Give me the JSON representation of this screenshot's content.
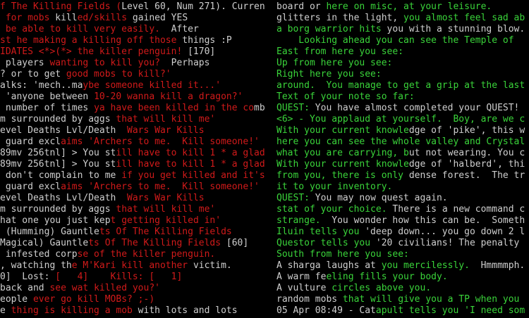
{
  "left_lines": [
    [
      {
        "t": "f The Killing Fields (",
        "c": "r"
      },
      {
        "t": "Level 60, Num 271). Curren",
        "c": "w"
      }
    ],
    [
      {
        "t": " for mobs ",
        "c": "r"
      },
      {
        "t": "kill",
        "c": "w"
      },
      {
        "t": "ed/skills ",
        "c": "r"
      },
      {
        "t": "gained YES",
        "c": "w"
      }
    ],
    [
      {
        "t": " be able to kill very easily.  ",
        "c": "r"
      },
      {
        "t": "After",
        "c": "w"
      }
    ],
    [
      {
        "t": "st he making a killing off those ",
        "c": "r"
      },
      {
        "t": "things :P",
        "c": "w"
      }
    ],
    [
      {
        "t": "IDATES <*>(*> the killer penguin! ",
        "c": "r"
      },
      {
        "t": "[170]",
        "c": "w"
      }
    ],
    [
      {
        "t": " players ",
        "c": "w"
      },
      {
        "t": "wanting to kill you?  ",
        "c": "r"
      },
      {
        "t": "Perhaps",
        "c": "w"
      }
    ],
    [
      {
        "t": "? or to get ",
        "c": "w"
      },
      {
        "t": "good mobs to kill?'",
        "c": "r"
      }
    ],
    [
      {
        "t": "alks: 'mech..ma",
        "c": "w"
      },
      {
        "t": "ybe someone killed it...'",
        "c": "r"
      }
    ],
    [
      {
        "t": " 'anyone between ",
        "c": "w"
      },
      {
        "t": "10-20 wanna kill a dragon?'",
        "c": "r"
      }
    ],
    [
      {
        "t": " number of times ",
        "c": "w"
      },
      {
        "t": "ya have been killed in the co",
        "c": "r"
      },
      {
        "t": "mb",
        "c": "w"
      }
    ],
    [
      {
        "t": "m surrounded by aggs ",
        "c": "w"
      },
      {
        "t": "that will kill me'",
        "c": "r"
      }
    ],
    [
      {
        "t": "evel Deaths Lvl/Death  ",
        "c": "w"
      },
      {
        "t": "Wars War Kills",
        "c": "r"
      }
    ],
    [
      {
        "t": " guard excl",
        "c": "w"
      },
      {
        "t": "aims 'Archers to me.  Kill someone!'",
        "c": "r"
      }
    ],
    [
      {
        "t": "89mv 256tnl] > You st",
        "c": "w"
      },
      {
        "t": "ill have to kill 1 * a glad",
        "c": "r"
      }
    ],
    [
      {
        "t": "89mv 256tnl] > You st",
        "c": "w"
      },
      {
        "t": "ill have to kill 1 * a glad",
        "c": "r"
      }
    ],
    [
      {
        "t": " don't complain to me ",
        "c": "w"
      },
      {
        "t": "if you get killed and it's",
        "c": "r"
      }
    ],
    [
      {
        "t": " guard excl",
        "c": "w"
      },
      {
        "t": "aims 'Archers to me.  Kill someone!'",
        "c": "r"
      }
    ],
    [
      {
        "t": "evel Deaths Lvl/Death  ",
        "c": "w"
      },
      {
        "t": "Wars War Kills",
        "c": "r"
      }
    ],
    [
      {
        "t": "m surrounded by aggs ",
        "c": "w"
      },
      {
        "t": "that will kill me'",
        "c": "r"
      }
    ],
    [
      {
        "t": "hat one you just kep",
        "c": "w"
      },
      {
        "t": "t getting killed in'",
        "c": "r"
      }
    ],
    [
      {
        "t": " (Humming) Gauntle",
        "c": "w"
      },
      {
        "t": "ts Of The Killing Fields",
        "c": "r"
      }
    ],
    [
      {
        "t": "Magical) Gauntle",
        "c": "w"
      },
      {
        "t": "ts Of The Killing Fields ",
        "c": "r"
      },
      {
        "t": "[60]",
        "c": "w"
      }
    ],
    [
      {
        "t": " infested corp",
        "c": "w"
      },
      {
        "t": "se of the killer penguin.",
        "c": "r"
      }
    ],
    [
      {
        "t": ", watching th",
        "c": "w"
      },
      {
        "t": "e M'Kari kill another ",
        "c": "r"
      },
      {
        "t": "victim.",
        "c": "w"
      }
    ],
    [
      {
        "t": "0]  Lost: ",
        "c": "w"
      },
      {
        "t": "[   4]    Kills: [   1]",
        "c": "r"
      }
    ],
    [
      {
        "t": "back and ",
        "c": "w"
      },
      {
        "t": "see wat killed you?'",
        "c": "r"
      }
    ],
    [
      {
        "t": "eople ",
        "c": "w"
      },
      {
        "t": "ever go kill MOBs? ;-)",
        "c": "r"
      }
    ],
    [
      {
        "t": "e ",
        "c": "w"
      },
      {
        "t": "thing is killing a mob ",
        "c": "r"
      },
      {
        "t": "with lots and lots",
        "c": "w"
      }
    ]
  ],
  "right_lines": [
    [
      {
        "t": "board or ",
        "c": "w"
      },
      {
        "t": "here on misc, at your leisure.",
        "c": "g"
      }
    ],
    [
      {
        "t": "glitters in the light, ",
        "c": "w"
      },
      {
        "t": "you almost feel sad ab",
        "c": "g"
      }
    ],
    [
      {
        "t": "a borg warrior hits ",
        "c": "g"
      },
      {
        "t": "you with a stunning blow.",
        "c": "w"
      }
    ],
    [
      {
        "t": "    Looking ahead ",
        "c": "g"
      },
      {
        "t": "you can see the Temple of",
        "c": "g"
      }
    ],
    [
      {
        "t": "East from here ",
        "c": "g"
      },
      {
        "t": "you see:",
        "c": "g"
      }
    ],
    [
      {
        "t": "Up from here ",
        "c": "g"
      },
      {
        "t": "you see:",
        "c": "g"
      }
    ],
    [
      {
        "t": "Right here ",
        "c": "g"
      },
      {
        "t": "you see:",
        "c": "g"
      }
    ],
    [
      {
        "t": "around.  You manage to get a grip at the last",
        "c": "g"
      }
    ],
    [
      {
        "t": "Text of your note so far:",
        "c": "g"
      }
    ],
    [
      {
        "t": "QUEST: ",
        "c": "g"
      },
      {
        "t": "You have almost completed your QUEST!",
        "c": "w"
      }
    ],
    [
      {
        "t": "<6> - ",
        "c": "g"
      },
      {
        "t": "You applaud at yourself.  Boy, are we c",
        "c": "g"
      }
    ],
    [
      {
        "t": "With your current knowle",
        "c": "g"
      },
      {
        "t": "dge of 'pike', this w",
        "c": "w"
      }
    ],
    [
      {
        "t": "here you can see the whole valley and Crystal",
        "c": "g"
      }
    ],
    [
      {
        "t": "what you are carrying, b",
        "c": "g"
      },
      {
        "t": "ut not wearing. You c",
        "c": "w"
      }
    ],
    [
      {
        "t": "With your current knowle",
        "c": "g"
      },
      {
        "t": "dge of 'halberd', thi",
        "c": "w"
      }
    ],
    [
      {
        "t": "from you, there is only ",
        "c": "g"
      },
      {
        "t": "dense forest.  The tr",
        "c": "w"
      }
    ],
    [
      {
        "t": "it to your inventory.",
        "c": "g"
      }
    ],
    [
      {
        "t": "QUEST: ",
        "c": "g"
      },
      {
        "t": "You may now quest again.",
        "c": "w"
      }
    ],
    [
      {
        "t": "stat of your choice. ",
        "c": "g"
      },
      {
        "t": "There is a new command c",
        "c": "w"
      }
    ],
    [
      {
        "t": "strange.  ",
        "c": "g"
      },
      {
        "t": "You wonder how this can be.  Someth",
        "c": "w"
      }
    ],
    [
      {
        "t": "Iluin tells you ",
        "c": "g"
      },
      {
        "t": "'deep down... you go down 2 l",
        "c": "w"
      }
    ],
    [
      {
        "t": "Questor tells you ",
        "c": "g"
      },
      {
        "t": "'20 civilians! The penalty",
        "c": "w"
      }
    ],
    [
      {
        "t": "South from here ",
        "c": "g"
      },
      {
        "t": "you see:",
        "c": "g"
      }
    ],
    [
      {
        "t": "A sharga laughs at ",
        "c": "w"
      },
      {
        "t": "you mercilessly.  ",
        "c": "g"
      },
      {
        "t": "Hmmmmph.",
        "c": "w"
      }
    ],
    [
      {
        "t": "A warm fe",
        "c": "w"
      },
      {
        "t": "eling fills your body.",
        "c": "g"
      }
    ],
    [
      {
        "t": "A vulture ",
        "c": "w"
      },
      {
        "t": "circles above you.",
        "c": "g"
      }
    ],
    [
      {
        "t": "random mobs ",
        "c": "w"
      },
      {
        "t": "that will give you a TP when you",
        "c": "g"
      }
    ],
    [
      {
        "t": "05 Apr 08:49 - Cat",
        "c": "w"
      },
      {
        "t": "apult tells you 'I need som",
        "c": "g"
      }
    ]
  ],
  "colors": {
    "w": "#cfcfcf",
    "r": "#d11a1a",
    "g": "#3ad43a",
    "background": "#000000"
  }
}
